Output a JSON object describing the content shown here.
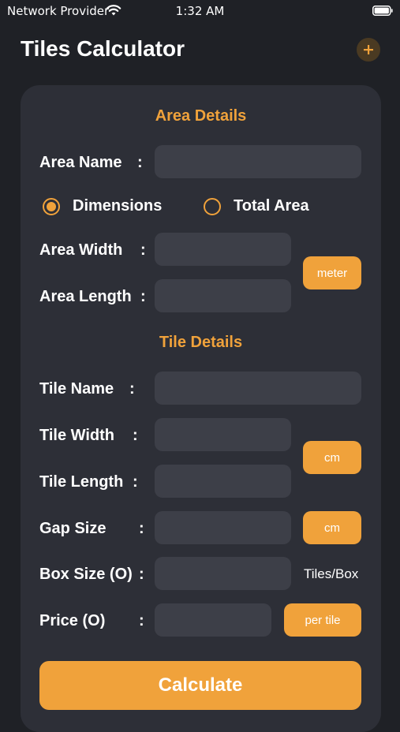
{
  "status_bar": {
    "provider": "Network Provider",
    "time": "1:32 AM",
    "wifi_icon": "wifi-icon",
    "battery_icon": "battery-icon"
  },
  "nav": {
    "title": "Tiles Calculator",
    "add_icon": "plus-icon"
  },
  "area_details": {
    "title": "Area Details",
    "area_name": {
      "label": "Area Name",
      "value": ""
    },
    "input_mode": {
      "options": [
        "Dimensions",
        "Total Area"
      ],
      "selected": "Dimensions"
    },
    "area_width": {
      "label": "Area Width",
      "value": ""
    },
    "area_length": {
      "label": "Area Length",
      "value": ""
    },
    "unit": "meter"
  },
  "tile_details": {
    "title": "Tile Details",
    "tile_name": {
      "label": "Tile Name",
      "value": ""
    },
    "tile_width": {
      "label": "Tile Width",
      "value": ""
    },
    "tile_length": {
      "label": "Tile Length",
      "value": ""
    },
    "tile_unit": "cm",
    "gap_size": {
      "label": "Gap Size",
      "value": "",
      "unit": "cm"
    },
    "box_size": {
      "label": "Box Size (O)",
      "value": "",
      "unit": "Tiles/Box"
    },
    "price": {
      "label": "Price (O)",
      "value": "",
      "unit": "per tile"
    }
  },
  "colon": ":",
  "calculate_label": "Calculate",
  "colors": {
    "accent": "#f0a23b",
    "background": "#1f2126",
    "card": "#2d2f37",
    "input": "#3d3f48"
  }
}
